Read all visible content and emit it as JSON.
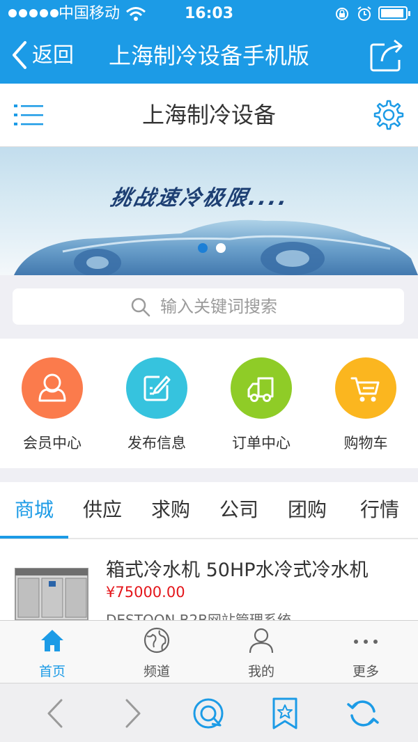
{
  "status": {
    "carrier": "中国移动",
    "time": "16:03"
  },
  "nav": {
    "back_label": "返回",
    "title": "上海制冷设备手机版"
  },
  "header": {
    "site_title": "上海制冷设备"
  },
  "banner": {
    "slogan": "挑战速冷极限....",
    "slide_count": 2,
    "active_slide": 1
  },
  "search": {
    "placeholder": "输入关键词搜索"
  },
  "quick_links": [
    {
      "label": "会员中心",
      "color": "#fb7b4c",
      "icon": "user-icon"
    },
    {
      "label": "发布信息",
      "color": "#36c3de",
      "icon": "edit-icon"
    },
    {
      "label": "订单中心",
      "color": "#8fcc27",
      "icon": "truck-icon"
    },
    {
      "label": "购物车",
      "color": "#fbb61f",
      "icon": "cart-icon"
    }
  ],
  "tabs": [
    "商城",
    "供应",
    "求购",
    "公司",
    "团购",
    "行情"
  ],
  "active_tab": "商城",
  "products": [
    {
      "title": "箱式冷水机 50HP水冷式冷水机",
      "price": "¥75000.00",
      "subtitle": "DESTOON B2B网站管理系统"
    }
  ],
  "tabbar": [
    {
      "label": "首页",
      "icon": "home-icon",
      "active": true
    },
    {
      "label": "频道",
      "icon": "globe-icon",
      "active": false
    },
    {
      "label": "我的",
      "icon": "person-icon",
      "active": false
    },
    {
      "label": "更多",
      "icon": "more-icon",
      "active": false
    }
  ],
  "colors": {
    "accent": "#1c9be6",
    "price": "#e4161b"
  }
}
